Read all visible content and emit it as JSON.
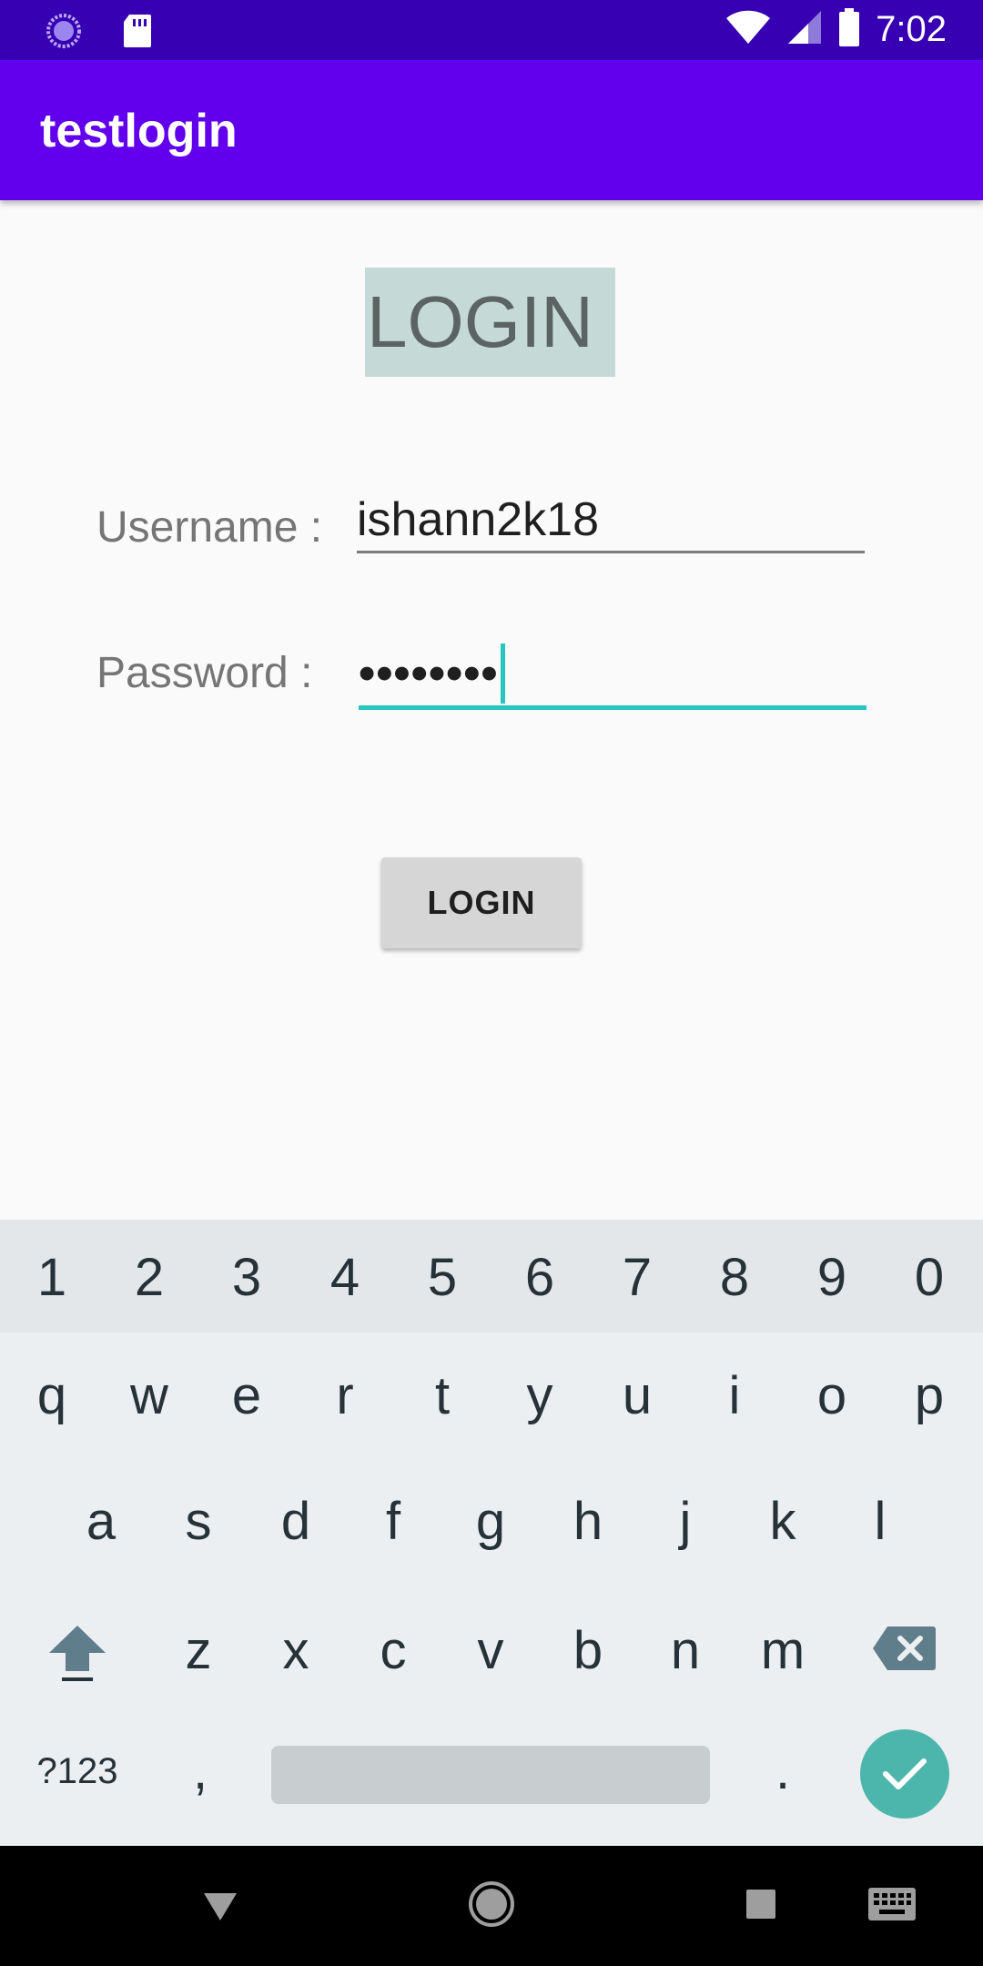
{
  "status_bar": {
    "time": "7:02",
    "icons": [
      "sync-icon",
      "sd-card-icon",
      "wifi-icon",
      "signal-icon",
      "battery-icon"
    ]
  },
  "app_bar": {
    "title": "testlogin"
  },
  "form": {
    "heading": "LOGIN",
    "username_label": "Username :",
    "username_value": "ishann2k18",
    "password_label": "Password :",
    "password_mask": "••••••••",
    "submit_label": "LOGIN"
  },
  "keyboard": {
    "number_row": [
      "1",
      "2",
      "3",
      "4",
      "5",
      "6",
      "7",
      "8",
      "9",
      "0"
    ],
    "row1": [
      "q",
      "w",
      "e",
      "r",
      "t",
      "y",
      "u",
      "i",
      "o",
      "p"
    ],
    "row2": [
      "a",
      "s",
      "d",
      "f",
      "g",
      "h",
      "j",
      "k",
      "l"
    ],
    "row3": [
      "z",
      "x",
      "c",
      "v",
      "b",
      "n",
      "m"
    ],
    "symbols_label": "?123",
    "comma": ",",
    "period": ".",
    "icons": [
      "shift-icon",
      "backspace-icon",
      "check-icon"
    ]
  },
  "nav_bar": {
    "icons": [
      "back-icon",
      "home-icon",
      "recents-icon",
      "keyboard-switch-icon"
    ]
  },
  "colors": {
    "status_bar": "#3700b3",
    "app_bar": "#6200ee",
    "accent": "#26c6bf",
    "heading_bg": "#c5d9d6",
    "enter_key": "#4db6ac"
  }
}
